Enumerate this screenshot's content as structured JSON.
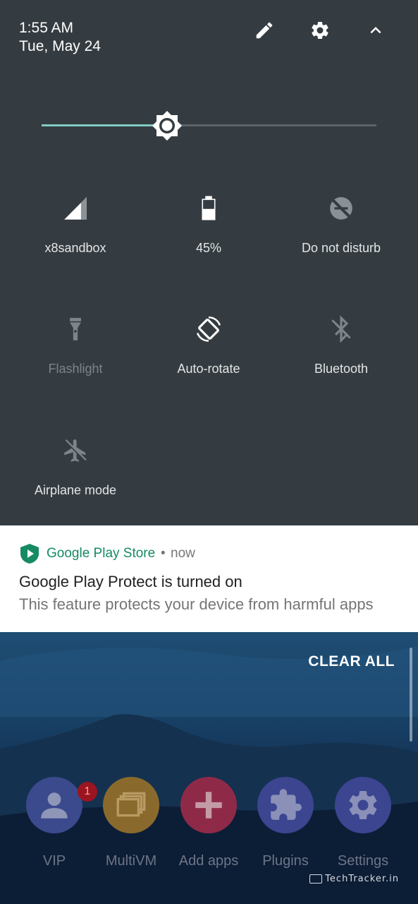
{
  "status": {
    "time": "1:55 AM",
    "date": "Tue, May 24"
  },
  "top_icons": [
    {
      "name": "edit-icon"
    },
    {
      "name": "settings-gear-icon"
    },
    {
      "name": "collapse-chevron-icon"
    }
  ],
  "brightness": {
    "level": 0.375
  },
  "tiles": [
    {
      "label": "x8sandbox",
      "icon": "signal-icon",
      "active": true
    },
    {
      "label": "45%",
      "icon": "battery-icon",
      "active": true
    },
    {
      "label": "Do not disturb",
      "icon": "do-not-disturb-icon",
      "active": false
    },
    {
      "label": "Flashlight",
      "icon": "flashlight-icon",
      "active": false
    },
    {
      "label": "Auto-rotate",
      "icon": "auto-rotate-icon",
      "active": true
    },
    {
      "label": "Bluetooth",
      "icon": "bluetooth-icon",
      "active": false
    },
    {
      "label": "Airplane mode",
      "icon": "airplane-icon",
      "active": false
    }
  ],
  "notification": {
    "app": "Google Play Store",
    "separator": "•",
    "time": "now",
    "title": "Google Play Protect is turned on",
    "text": "This feature protects your device from harmful apps",
    "accent": "#168a64"
  },
  "home": {
    "clear_all": "CLEAR ALL",
    "dock": [
      {
        "label": "VIP",
        "icon": "person-icon",
        "color": "#3a4a8c",
        "badge": "1"
      },
      {
        "label": "MultiVM",
        "icon": "multi-window-icon",
        "color": "#8a6a2c"
      },
      {
        "label": "Add apps",
        "icon": "plus-icon",
        "color": "#8e2a48"
      },
      {
        "label": "Plugins",
        "icon": "puzzle-icon",
        "color": "#3b4590"
      },
      {
        "label": "Settings",
        "icon": "gear-icon",
        "color": "#3b4590"
      }
    ],
    "watermark": "TechTracker.in"
  }
}
